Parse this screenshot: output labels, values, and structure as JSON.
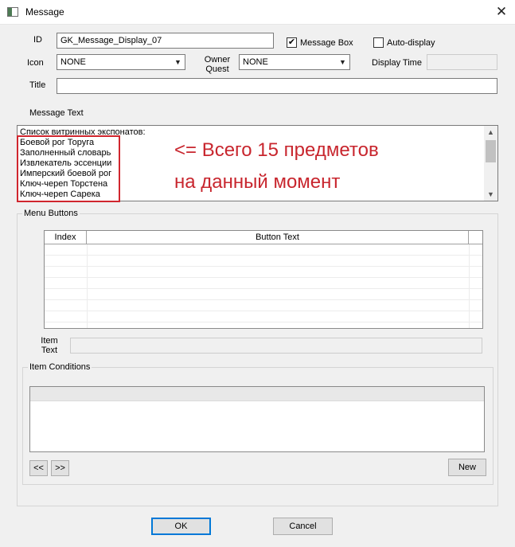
{
  "window": {
    "title": "Message",
    "close_glyph": "✕"
  },
  "fields": {
    "id_label": "ID",
    "id_value": "GK_Message_Display_07",
    "message_box_label": "Message Box",
    "message_box_checked": true,
    "auto_display_label": "Auto-display",
    "auto_display_checked": false,
    "icon_label": "Icon",
    "icon_value": "NONE",
    "owner_quest_label_1": "Owner",
    "owner_quest_label_2": "Quest",
    "owner_quest_value": "NONE",
    "display_time_label": "Display Time",
    "display_time_value": "",
    "title_label": "Title",
    "title_value": ""
  },
  "message_text": {
    "label": "Message Text",
    "lines": [
      "Список витринных экспонатов:",
      "Боевой рог Торуга",
      "Заполненный словарь",
      "Извлекатель эссенции",
      "Имперский боевой рог",
      "Ключ-череп Торстена",
      "Ключ-череп Сарека"
    ]
  },
  "annotation": {
    "line1": "<= Всего 15 предметов",
    "line2": "на данный момент",
    "color": "#c8262e"
  },
  "menu_buttons": {
    "group_label": "Menu Buttons",
    "columns": [
      "Index",
      "Button Text"
    ],
    "rows": [],
    "item_text_label_1": "Item",
    "item_text_label_2": "Text",
    "item_text_value": ""
  },
  "item_conditions": {
    "group_label": "Item Conditions",
    "prev_label": "<<",
    "next_label": ">>",
    "new_label": "New"
  },
  "dialog_buttons": {
    "ok_label": "OK",
    "cancel_label": "Cancel"
  },
  "icons": {
    "app": "app-window-icon",
    "combo_arrow": "▼",
    "scroll_up": "▲",
    "scroll_down": "▼",
    "checkmark": "✔"
  }
}
